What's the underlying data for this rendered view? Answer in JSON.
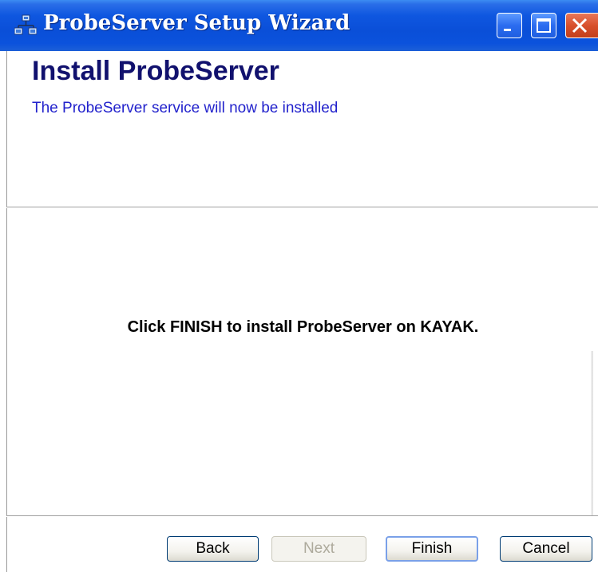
{
  "window": {
    "title": "ProbeServer Setup Wizard",
    "icon": "network-computers-icon"
  },
  "header": {
    "title": "Install ProbeServer",
    "subtitle": "The ProbeServer service will now be installed"
  },
  "content": {
    "message": "Click FINISH to install ProbeServer on KAYAK."
  },
  "buttons": {
    "back": "Back",
    "next": "Next",
    "finish": "Finish",
    "cancel": "Cancel"
  },
  "colors": {
    "titlebar": "#0a4fd8",
    "header_title": "#11116e",
    "subtitle": "#2222cc",
    "close_button": "#d8502c"
  }
}
